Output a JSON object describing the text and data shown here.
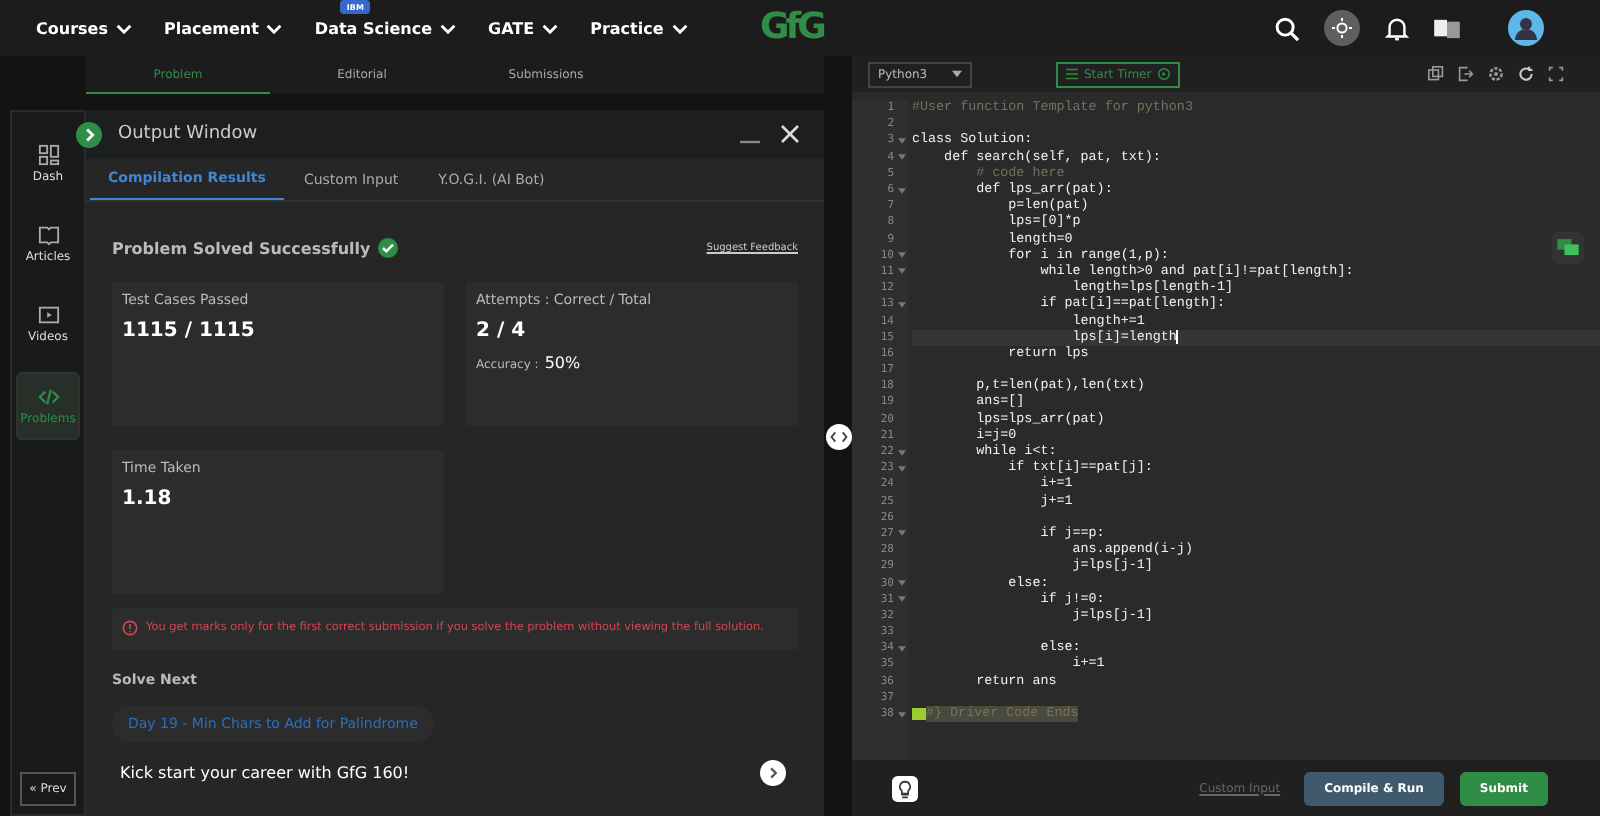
{
  "nav": {
    "items": [
      {
        "label": "Courses"
      },
      {
        "label": "Placement"
      },
      {
        "label": "Data Science",
        "badge": "IBM"
      },
      {
        "label": "GATE"
      },
      {
        "label": "Practice"
      }
    ],
    "logo": "GfG"
  },
  "problem_tabs": [
    {
      "label": "Problem",
      "selected": true
    },
    {
      "label": "Editorial",
      "selected": false
    },
    {
      "label": "Submissions",
      "selected": false
    }
  ],
  "rail": {
    "items": [
      {
        "label": "Dash",
        "selected": false
      },
      {
        "label": "Articles",
        "selected": false
      },
      {
        "label": "Videos",
        "selected": false
      },
      {
        "label": "Problems",
        "selected": true
      }
    ],
    "prev": "« Prev"
  },
  "output": {
    "title": "Output Window",
    "tabs": [
      {
        "label": "Compilation Results",
        "selected": true
      },
      {
        "label": "Custom Input",
        "selected": false
      },
      {
        "label": "Y.O.G.I. (AI Bot)",
        "selected": false
      }
    ],
    "status": "Problem Solved Successfully",
    "feedback": "Suggest Feedback",
    "cards": [
      {
        "label": "Test Cases Passed",
        "value": "1115 / 1115"
      },
      {
        "label": "Attempts : Correct / Total",
        "value": "2 / 4",
        "extra_label": "Accuracy :",
        "extra_value": "50%"
      },
      {
        "label": "Time Taken",
        "value": "1.18"
      }
    ],
    "notice": "You get marks only for the first correct submission if you solve the problem without viewing the full solution.",
    "solve_next": "Solve Next",
    "next_problem": "Day 19 - Min Chars to Add for Palindrome",
    "promo": "Kick start your career with GfG 160!"
  },
  "editor": {
    "language": "Python3",
    "timer": "Start Timer",
    "lines": [
      {
        "n": "1",
        "text": "#User function Template for python3",
        "kind": "comment",
        "fold": false,
        "active": false
      },
      {
        "n": "2",
        "kind": "blank",
        "fold": false,
        "active": false
      },
      {
        "n": "3",
        "text": "class Solution:",
        "kind": "code",
        "fold": true,
        "active": false
      },
      {
        "n": "4",
        "text": "    def search(self, pat, txt):",
        "kind": "code",
        "fold": true,
        "active": false
      },
      {
        "n": "5",
        "text": "        # code here",
        "kind": "comment",
        "fold": false,
        "active": false
      },
      {
        "n": "6",
        "text": "        def lps_arr(pat):",
        "kind": "code",
        "fold": true,
        "active": false
      },
      {
        "n": "7",
        "text": "            p=len(pat)",
        "kind": "code",
        "fold": false,
        "active": false
      },
      {
        "n": "8",
        "text": "            lps=[0]*p",
        "kind": "code",
        "fold": false,
        "active": false
      },
      {
        "n": "9",
        "text": "            length=0",
        "kind": "code",
        "fold": false,
        "active": false
      },
      {
        "n": "10",
        "text": "            for i in range(1,p):",
        "kind": "code",
        "fold": true,
        "active": false
      },
      {
        "n": "11",
        "text": "                while length>0 and pat[i]!=pat[length]:",
        "kind": "code",
        "fold": true,
        "active": false
      },
      {
        "n": "12",
        "text": "                    length=lps[length-1]",
        "kind": "code",
        "fold": false,
        "active": false
      },
      {
        "n": "13",
        "text": "                if pat[i]==pat[length]:",
        "kind": "code",
        "fold": true,
        "active": false
      },
      {
        "n": "14",
        "text": "                    length+=1",
        "kind": "code",
        "fold": false,
        "active": false
      },
      {
        "n": "15",
        "text": "                    lps[i]=length",
        "kind": "code",
        "fold": false,
        "active": true
      },
      {
        "n": "16",
        "text": "            return lps",
        "kind": "code",
        "fold": false,
        "active": false
      },
      {
        "n": "17",
        "kind": "blank",
        "fold": false,
        "active": false
      },
      {
        "n": "18",
        "text": "        p,t=len(pat),len(txt)",
        "kind": "code",
        "fold": false,
        "active": false
      },
      {
        "n": "19",
        "text": "        ans=[]",
        "kind": "code",
        "fold": false,
        "active": false
      },
      {
        "n": "20",
        "text": "        lps=lps_arr(pat)",
        "kind": "code",
        "fold": false,
        "active": false
      },
      {
        "n": "21",
        "text": "        i=j=0",
        "kind": "code",
        "fold": false,
        "active": false
      },
      {
        "n": "22",
        "text": "        while i<t:",
        "kind": "code",
        "fold": true,
        "active": false
      },
      {
        "n": "23",
        "text": "            if txt[i]==pat[j]:",
        "kind": "code",
        "fold": true,
        "active": false
      },
      {
        "n": "24",
        "text": "                i+=1",
        "kind": "code",
        "fold": false,
        "active": false
      },
      {
        "n": "25",
        "text": "                j+=1",
        "kind": "code",
        "fold": false,
        "active": false
      },
      {
        "n": "26",
        "kind": "blank",
        "fold": false,
        "active": false
      },
      {
        "n": "27",
        "text": "                if j==p:",
        "kind": "code",
        "fold": true,
        "active": false
      },
      {
        "n": "28",
        "text": "                    ans.append(i-j)",
        "kind": "code",
        "fold": false,
        "active": false
      },
      {
        "n": "29",
        "text": "                    j=lps[j-1]",
        "kind": "code",
        "fold": false,
        "active": false
      },
      {
        "n": "30",
        "text": "            else:",
        "kind": "code",
        "fold": true,
        "active": false
      },
      {
        "n": "31",
        "text": "                if j!=0:",
        "kind": "code",
        "fold": true,
        "active": false
      },
      {
        "n": "32",
        "text": "                    j=lps[j-1]",
        "kind": "code",
        "fold": false,
        "active": false
      },
      {
        "n": "33",
        "kind": "blank",
        "fold": false,
        "active": false
      },
      {
        "n": "34",
        "text": "                else:",
        "kind": "code",
        "fold": true,
        "active": false
      },
      {
        "n": "35",
        "text": "                    i+=1",
        "kind": "code",
        "fold": false,
        "active": false
      },
      {
        "n": "36",
        "text": "        return ans",
        "kind": "code",
        "fold": false,
        "active": false
      },
      {
        "n": "37",
        "kind": "blank",
        "fold": false,
        "active": false
      },
      {
        "n": "38",
        "text": "#} Driver Code Ends",
        "kind": "selected-comment",
        "fold": true,
        "active": false
      }
    ],
    "custom_input": "Custom Input",
    "compile": "Compile & Run",
    "submit": "Submit"
  }
}
